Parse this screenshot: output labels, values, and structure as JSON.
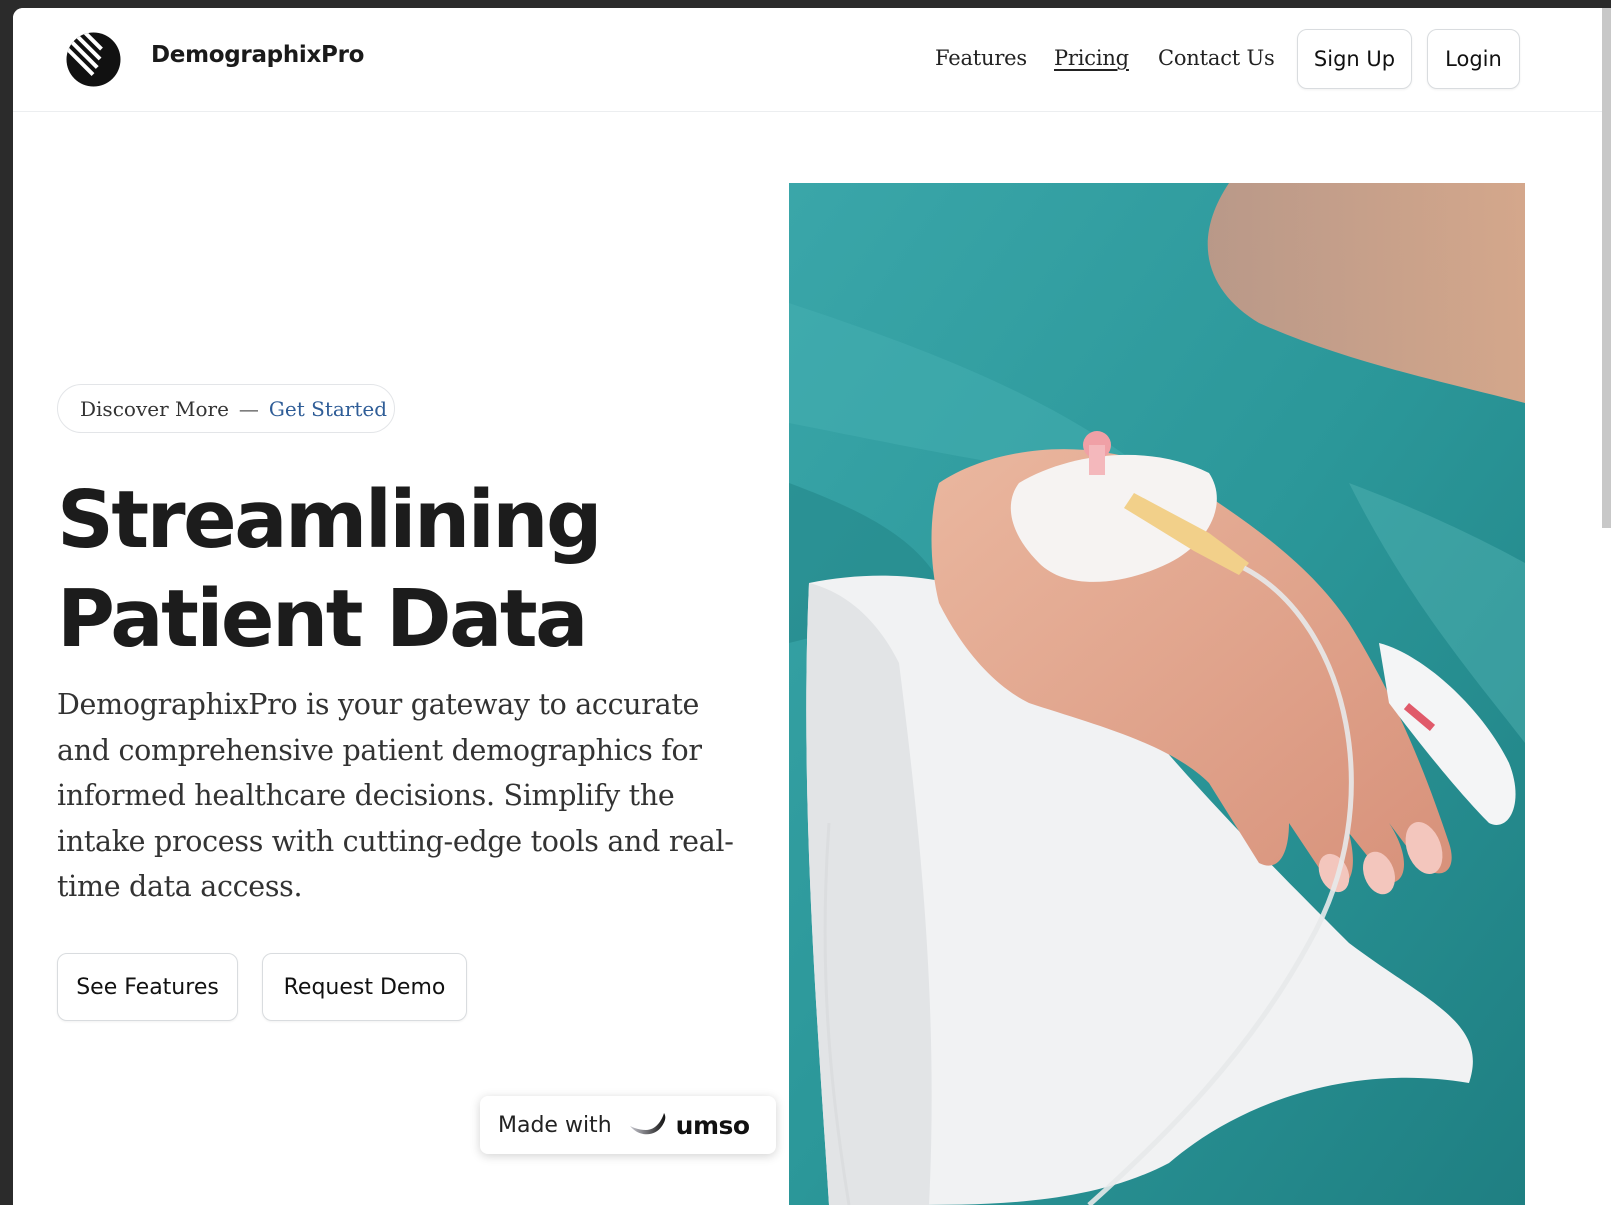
{
  "header": {
    "brand": "DemographixPro",
    "nav": [
      {
        "label": "Features"
      },
      {
        "label": "Pricing"
      },
      {
        "label": "Contact Us"
      }
    ],
    "signup_label": "Sign Up",
    "login_label": "Login"
  },
  "hero": {
    "pill_text": "Discover More",
    "pill_separator": "—",
    "pill_link": "Get Started",
    "title_line1": "Streamlining",
    "title_line2": "Patient Data",
    "description": "DemographixPro is your gateway to accurate and comprehensive patient demographics for informed healthcare decisions. Simplify the intake process with cutting-edge tools and real-time data access.",
    "cta_primary": "See Features",
    "cta_secondary": "Request Demo"
  },
  "badge": {
    "prefix": "Made with",
    "brand": "umso"
  },
  "icons": {
    "logo": "striped-circle-logo-icon",
    "badge_logo": "umso-swoosh-icon"
  },
  "colors": {
    "accent_link": "#2f5d97",
    "text_dark": "#1c1c1c",
    "photo_teal": "#2a9a9c"
  }
}
